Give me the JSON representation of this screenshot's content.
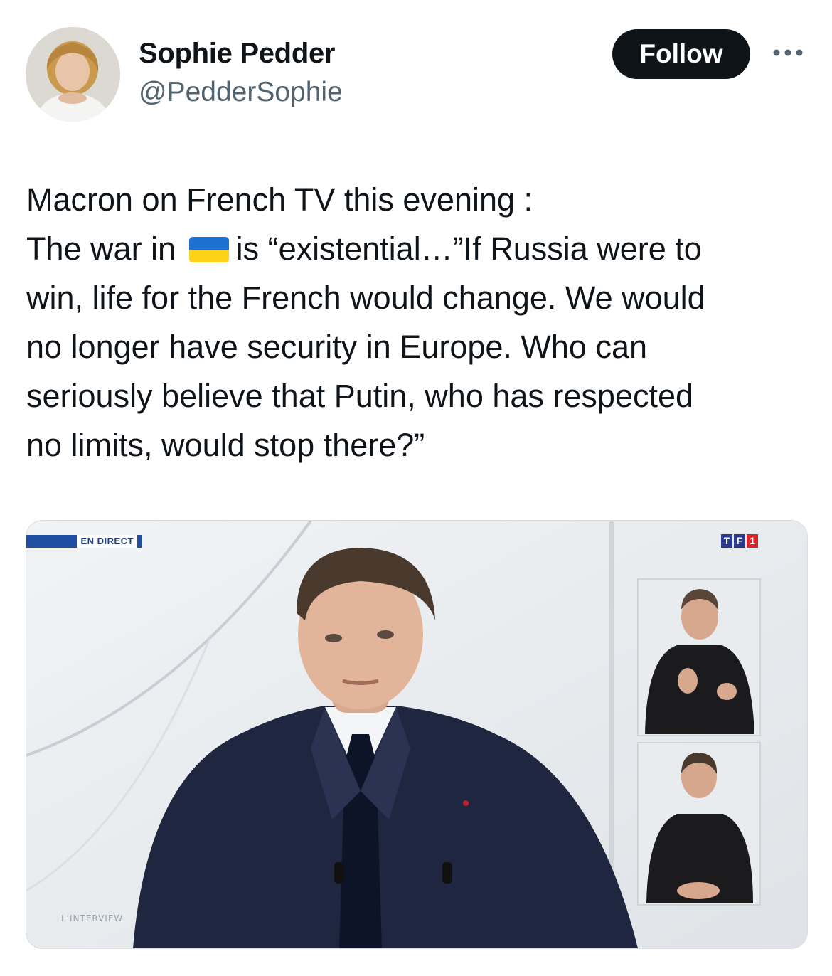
{
  "author": {
    "display_name": "Sophie Pedder",
    "handle": "@PedderSophie"
  },
  "actions": {
    "follow_label": "Follow"
  },
  "tweet": {
    "line1": "Macron on French TV this evening :",
    "line2_before_flag": "The war in",
    "flag_icon": "ukraine-flag-icon",
    "line2_after_flag": "is “existential…”If Russia were to",
    "line3": "win, life for the French would change. We would",
    "line4": "no longer have security in Europe. Who can",
    "line5": "seriously believe that Putin, who has respected",
    "line6": "no limits, would stop there?”"
  },
  "media": {
    "live_badge": "EN DIRECT",
    "channel_logo": [
      "T",
      "F",
      "1"
    ],
    "lower_label": "L'INTERVIEW"
  },
  "colors": {
    "follow_bg": "#0f1419",
    "handle": "#536471",
    "flag_blue": "#1f6fd1",
    "flag_yellow": "#ffd21a"
  }
}
